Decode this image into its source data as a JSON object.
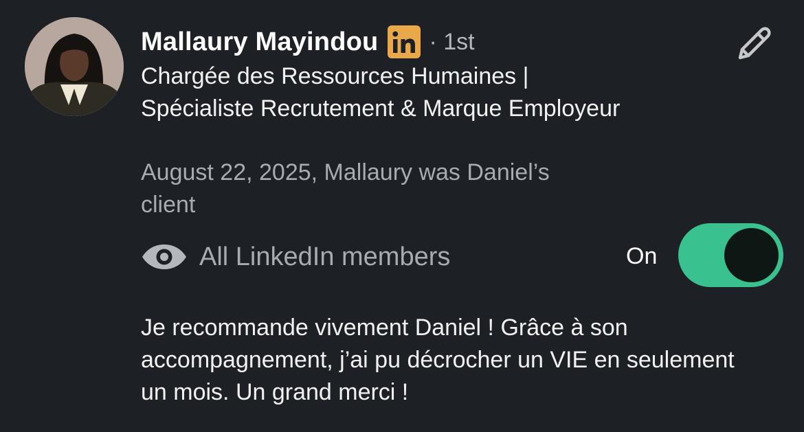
{
  "recommendation": {
    "author": {
      "name": "Mallaury Mayindou",
      "network_badge": "in",
      "connection_degree": "· 1st",
      "headline": "Chargée des Ressources Humaines | Spécialiste Recrutement & Marque Employeur"
    },
    "relationship": "August 22, 2025, Mallaury was Daniel’s client",
    "visibility": {
      "icon": "eye-icon",
      "label": "All LinkedIn members",
      "toggle_label": "On",
      "toggle_state": true
    },
    "text": "Je recommande vivement Daniel ! Grâce à son accompagnement, j’ai pu décrocher un VIE en seulement un mois. Un grand merci !",
    "edit_icon": "pencil-icon"
  },
  "colors": {
    "background": "#1d2126",
    "badge": "#e9a94b",
    "toggle_on": "#39c18f",
    "secondary_text": "#a8abaf"
  }
}
